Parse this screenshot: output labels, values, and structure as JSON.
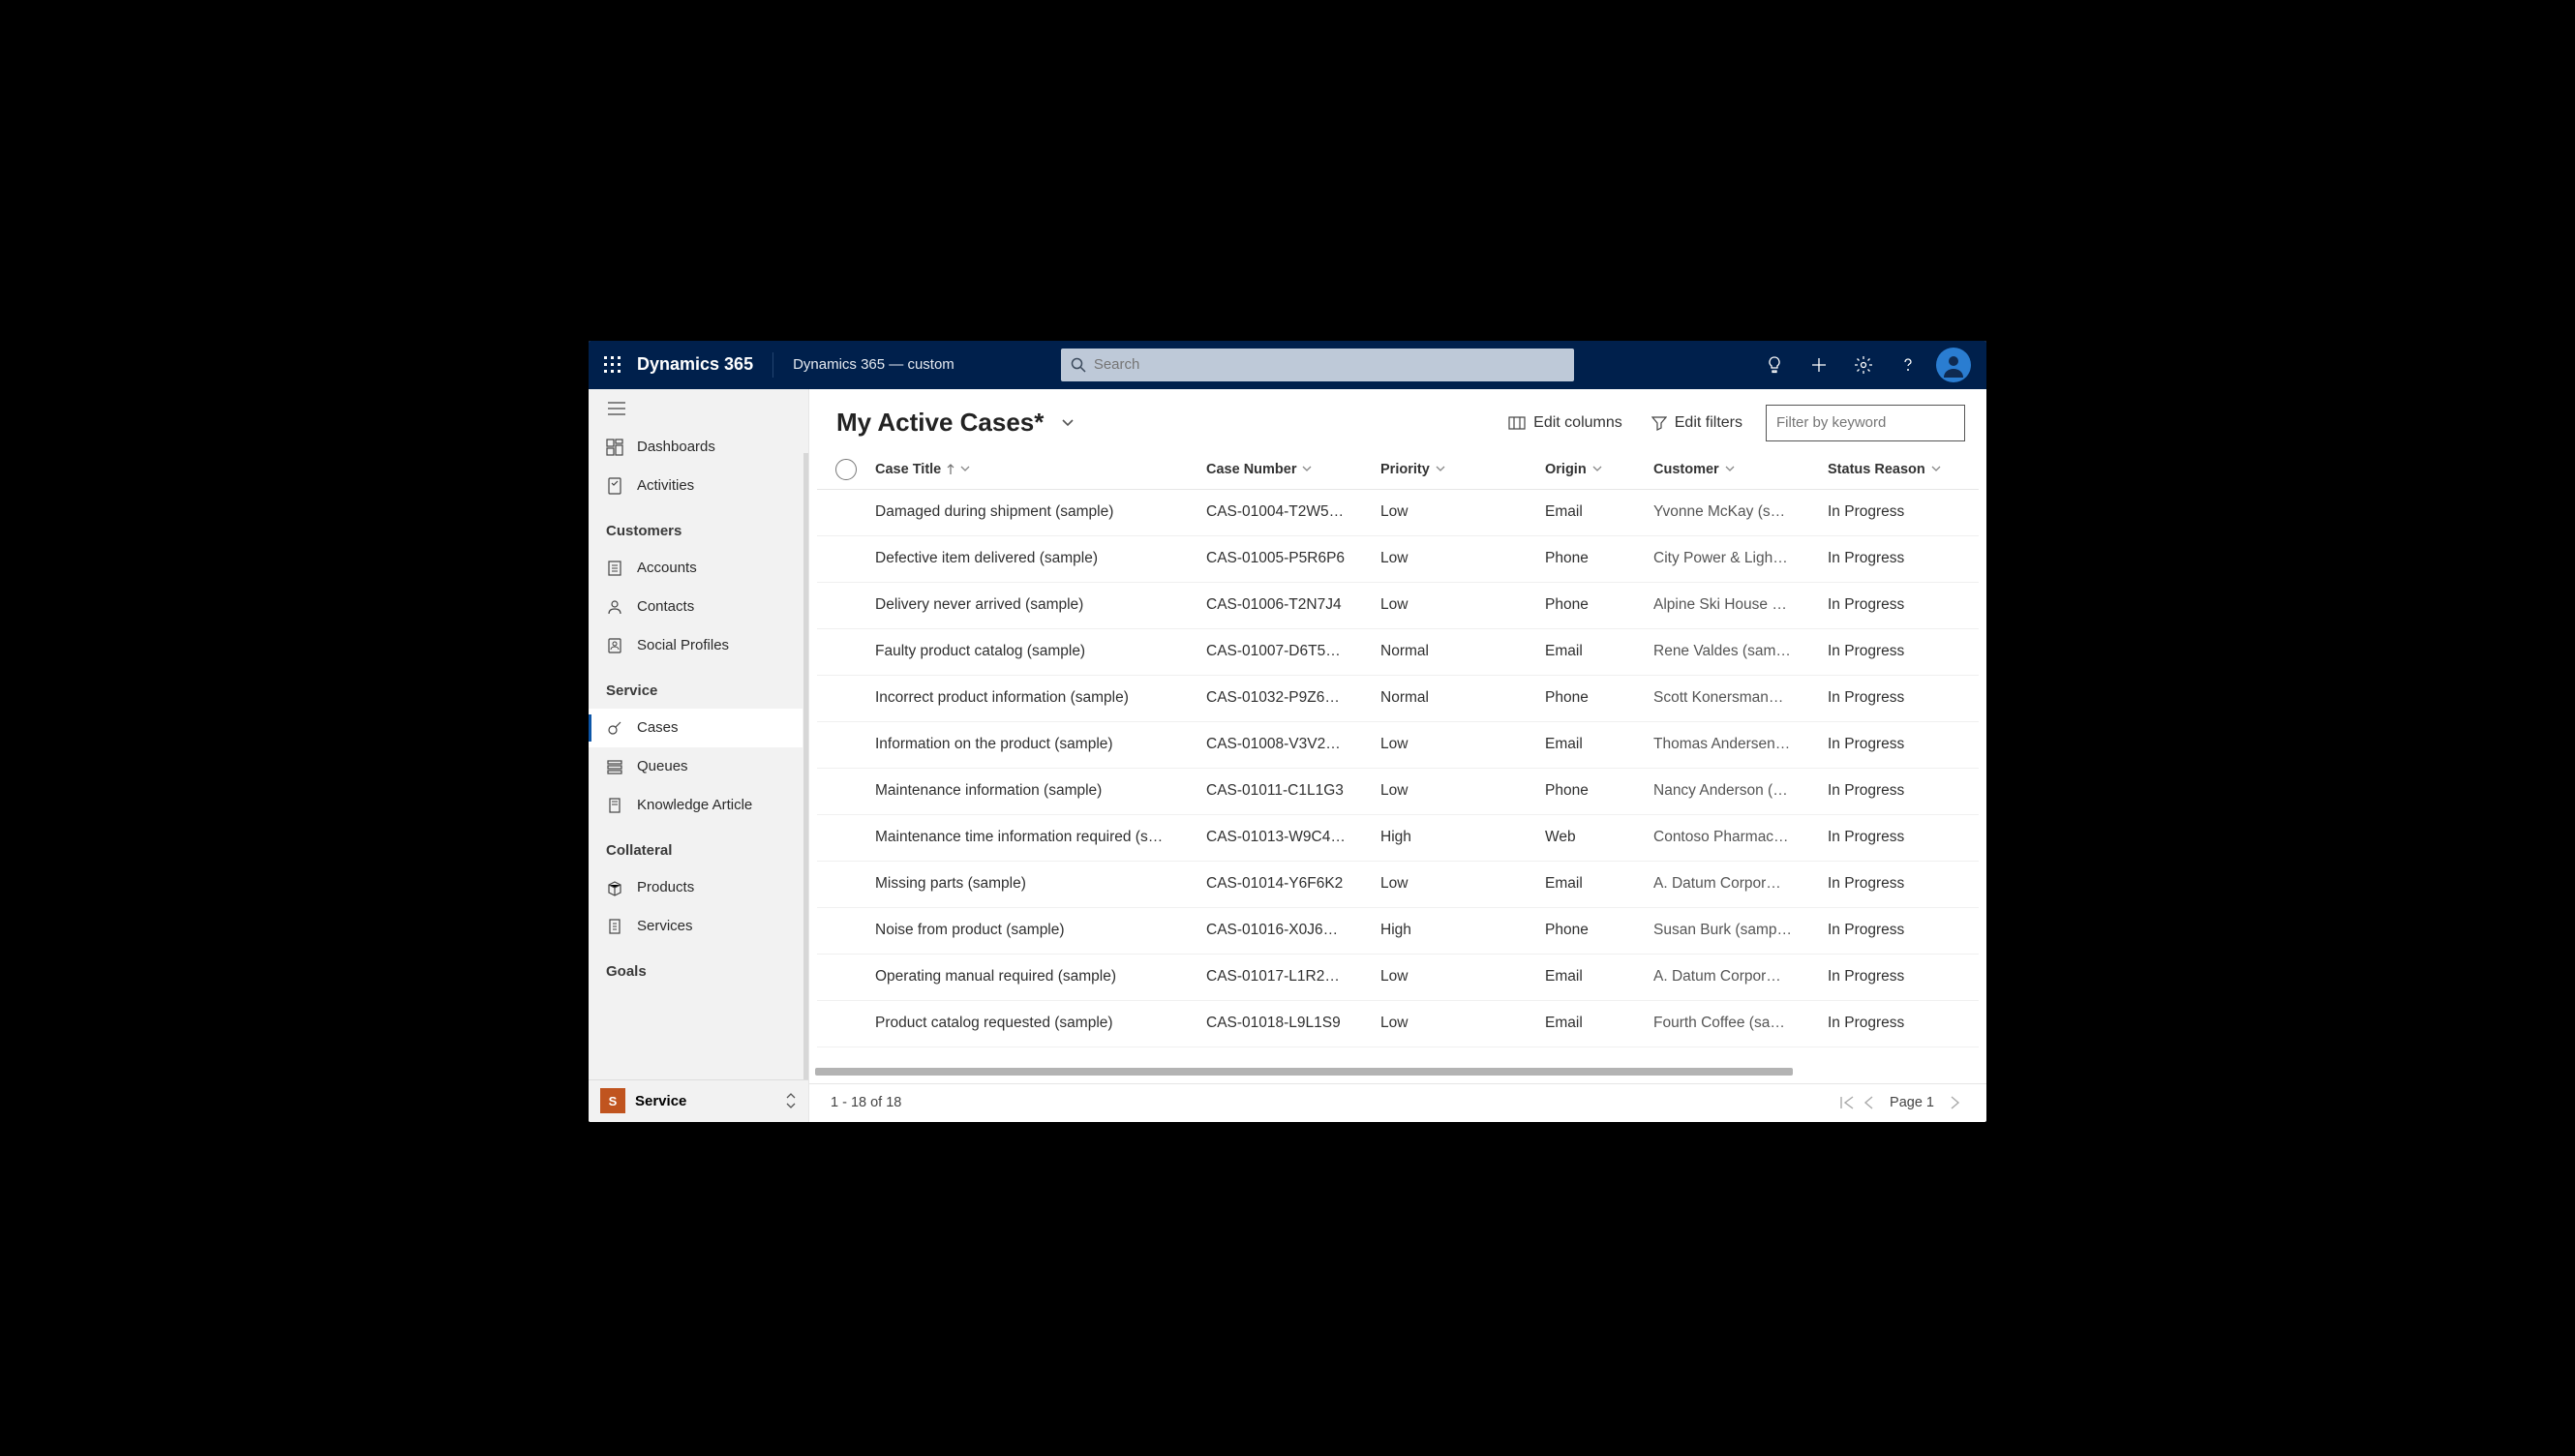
{
  "topbar": {
    "brand": "Dynamics 365",
    "app_name": "Dynamics 365 — custom",
    "search_placeholder": "Search"
  },
  "sidebar": {
    "top_items": [
      {
        "label": "Dashboards"
      },
      {
        "label": "Activities"
      }
    ],
    "groups": [
      {
        "title": "Customers",
        "items": [
          {
            "label": "Accounts"
          },
          {
            "label": "Contacts"
          },
          {
            "label": "Social Profiles"
          }
        ]
      },
      {
        "title": "Service",
        "items": [
          {
            "label": "Cases",
            "active": true
          },
          {
            "label": "Queues"
          },
          {
            "label": "Knowledge Article"
          }
        ]
      },
      {
        "title": "Collateral",
        "items": [
          {
            "label": "Products"
          },
          {
            "label": "Services"
          }
        ]
      },
      {
        "title": "Goals",
        "items": []
      }
    ],
    "switcher": {
      "letter": "S",
      "label": "Service"
    }
  },
  "main": {
    "view_title": "My Active Cases*",
    "edit_columns": "Edit columns",
    "edit_filters": "Edit filters",
    "filter_placeholder": "Filter by keyword",
    "columns": [
      {
        "label": "Case Title",
        "sorted": true
      },
      {
        "label": "Case Number"
      },
      {
        "label": "Priority"
      },
      {
        "label": "Origin"
      },
      {
        "label": "Customer"
      },
      {
        "label": "Status Reason"
      }
    ],
    "rows": [
      {
        "title": "Damaged during shipment (sample)",
        "num": "CAS-01004-T2W5…",
        "pri": "Low",
        "ori": "Email",
        "cus": "Yvonne McKay (s…",
        "sta": "In Progress"
      },
      {
        "title": "Defective item delivered (sample)",
        "num": "CAS-01005-P5R6P6",
        "pri": "Low",
        "ori": "Phone",
        "cus": "City Power & Ligh…",
        "sta": "In Progress"
      },
      {
        "title": "Delivery never arrived (sample)",
        "num": "CAS-01006-T2N7J4",
        "pri": "Low",
        "ori": "Phone",
        "cus": "Alpine Ski House …",
        "sta": "In Progress"
      },
      {
        "title": "Faulty product catalog (sample)",
        "num": "CAS-01007-D6T5…",
        "pri": "Normal",
        "ori": "Email",
        "cus": "Rene Valdes (sam…",
        "sta": "In Progress"
      },
      {
        "title": "Incorrect product information (sample)",
        "num": "CAS-01032-P9Z6…",
        "pri": "Normal",
        "ori": "Phone",
        "cus": "Scott Konersman…",
        "sta": "In Progress"
      },
      {
        "title": "Information on the product (sample)",
        "num": "CAS-01008-V3V2…",
        "pri": "Low",
        "ori": "Email",
        "cus": "Thomas Andersen…",
        "sta": "In Progress"
      },
      {
        "title": "Maintenance information (sample)",
        "num": "CAS-01011-C1L1G3",
        "pri": "Low",
        "ori": "Phone",
        "cus": "Nancy Anderson (…",
        "sta": "In Progress"
      },
      {
        "title": "Maintenance time information required (s…",
        "num": "CAS-01013-W9C4…",
        "pri": "High",
        "ori": "Web",
        "cus": "Contoso Pharmac…",
        "sta": "In Progress"
      },
      {
        "title": "Missing parts (sample)",
        "num": "CAS-01014-Y6F6K2",
        "pri": "Low",
        "ori": "Email",
        "cus": "A. Datum Corpor…",
        "sta": "In Progress"
      },
      {
        "title": "Noise from product (sample)",
        "num": "CAS-01016-X0J6…",
        "pri": "High",
        "ori": "Phone",
        "cus": "Susan Burk (samp…",
        "sta": "In Progress"
      },
      {
        "title": "Operating manual required (sample)",
        "num": "CAS-01017-L1R2…",
        "pri": "Low",
        "ori": "Email",
        "cus": "A. Datum Corpor…",
        "sta": "In Progress"
      },
      {
        "title": "Product catalog requested (sample)",
        "num": "CAS-01018-L9L1S9",
        "pri": "Low",
        "ori": "Email",
        "cus": "Fourth Coffee (sa…",
        "sta": "In Progress"
      }
    ],
    "record_count": "1 - 18 of 18",
    "page_label": "Page 1"
  }
}
